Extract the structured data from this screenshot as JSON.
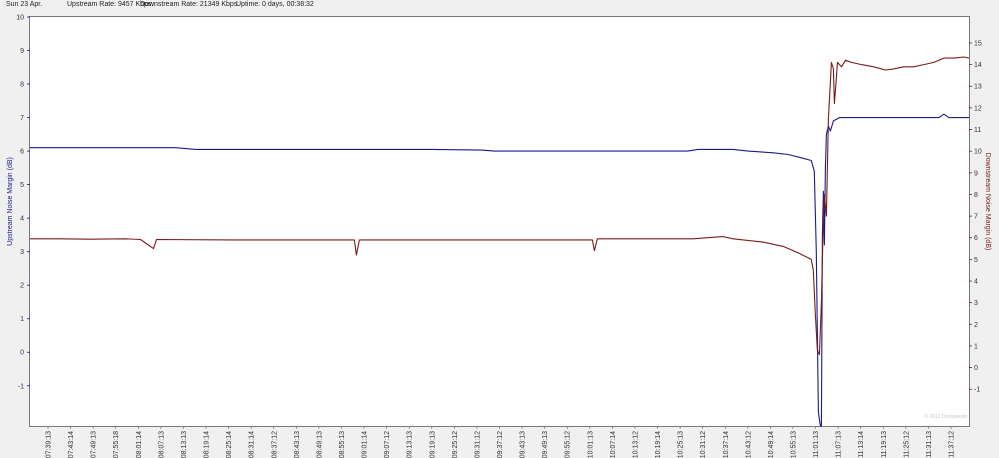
{
  "header": {
    "date": "Sun 23 Apr.",
    "upstream_rate": "Upstream Rate: 9457 Kbps.",
    "downstream_rate": "Downstream Rate: 21349 Kbps.",
    "uptime": "Uptime: 0 days, 00:38:32"
  },
  "watermark": "© 2012 Dezspeeds",
  "chart_data": {
    "type": "line",
    "x_tick_labels": [
      "07:39:13",
      "07:43:14",
      "07:49:13",
      "07:55:18",
      "08:01:14",
      "08:07:13",
      "08:13:13",
      "08:19:14",
      "08:25:14",
      "08:31:14",
      "08:37:12",
      "08:43:13",
      "08:49:13",
      "08:55:13",
      "09:01:14",
      "09:07:12",
      "09:13:13",
      "09:19:13",
      "09:25:12",
      "09:31:12",
      "09:37:12",
      "09:43:13",
      "09:49:13",
      "09:55:12",
      "10:01:13",
      "10:07:14",
      "10:13:12",
      "10:19:14",
      "10:25:13",
      "10:31:12",
      "10:37:14",
      "10:43:12",
      "10:49:14",
      "10:55:13",
      "11:01:13",
      "11:07:13",
      "11:13:14",
      "11:19:13",
      "11:25:12",
      "11:31:13",
      "11:37:12"
    ],
    "left_axis": {
      "label": "Upstream Noise Margin (dB)",
      "range": [
        -2.2,
        10
      ],
      "ticks": [
        -1,
        0,
        1,
        2,
        3,
        4,
        5,
        6,
        7,
        8,
        9,
        10
      ],
      "color": "#1a1a8c"
    },
    "right_axis": {
      "label": "Downstream Noise Margin (dB)",
      "range": [
        -2.7,
        16.2
      ],
      "ticks": [
        -1,
        0,
        1,
        2,
        3,
        4,
        5,
        6,
        7,
        8,
        9,
        10,
        11,
        12,
        13,
        14,
        15
      ],
      "color": "#7a1a1a"
    },
    "grid": false,
    "series": [
      {
        "name": "Upstream Noise Margin (dB)",
        "axis": "left",
        "color": "#1a1a8c",
        "points": [
          [
            0,
            6.1
          ],
          [
            145,
            6.1
          ],
          [
            165,
            6.05
          ],
          [
            200,
            6.05
          ],
          [
            300,
            6.05
          ],
          [
            400,
            6.05
          ],
          [
            450,
            6.03
          ],
          [
            462,
            6.0
          ],
          [
            600,
            6.0
          ],
          [
            655,
            6.0
          ],
          [
            665,
            6.05
          ],
          [
            700,
            6.05
          ],
          [
            715,
            6.0
          ],
          [
            740,
            5.95
          ],
          [
            755,
            5.9
          ],
          [
            768,
            5.8
          ],
          [
            778,
            5.72
          ],
          [
            781,
            5.4
          ],
          [
            783,
            3.0
          ],
          [
            785,
            -1.8
          ],
          [
            787,
            -2.2
          ],
          [
            788,
            -2.2
          ],
          [
            789,
            3.5
          ],
          [
            790,
            4.8
          ],
          [
            791,
            3.2
          ],
          [
            792,
            5.5
          ],
          [
            793,
            6.5
          ],
          [
            795,
            6.75
          ],
          [
            797,
            6.6
          ],
          [
            800,
            6.9
          ],
          [
            806,
            7.0
          ],
          [
            905,
            7.0
          ],
          [
            910,
            7.1
          ],
          [
            915,
            7.0
          ],
          [
            925,
            7.0
          ],
          [
            935,
            7.0
          ]
        ]
      },
      {
        "name": "Downstream Noise Margin (dB)",
        "axis": "right",
        "color": "#7a1a1a",
        "points": [
          [
            0,
            5.95
          ],
          [
            30,
            5.95
          ],
          [
            60,
            5.93
          ],
          [
            95,
            5.95
          ],
          [
            110,
            5.92
          ],
          [
            123,
            5.5
          ],
          [
            126,
            5.92
          ],
          [
            200,
            5.9
          ],
          [
            300,
            5.9
          ],
          [
            323,
            5.9
          ],
          [
            325,
            5.2
          ],
          [
            328,
            5.9
          ],
          [
            400,
            5.9
          ],
          [
            550,
            5.9
          ],
          [
            560,
            5.9
          ],
          [
            562,
            5.4
          ],
          [
            565,
            5.95
          ],
          [
            600,
            5.95
          ],
          [
            660,
            5.95
          ],
          [
            690,
            6.05
          ],
          [
            700,
            5.95
          ],
          [
            730,
            5.8
          ],
          [
            750,
            5.6
          ],
          [
            765,
            5.3
          ],
          [
            778,
            5.0
          ],
          [
            780,
            4.5
          ],
          [
            782,
            2.5
          ],
          [
            784,
            0.8
          ],
          [
            786,
            0.6
          ],
          [
            788,
            3.0
          ],
          [
            790,
            7.0
          ],
          [
            791,
            8.0
          ],
          [
            793,
            7.0
          ],
          [
            795,
            11.5
          ],
          [
            797,
            13.2
          ],
          [
            798,
            14.1
          ],
          [
            800,
            13.8
          ],
          [
            801,
            12.2
          ],
          [
            803,
            13.4
          ],
          [
            804,
            14.1
          ],
          [
            808,
            13.9
          ],
          [
            812,
            14.2
          ],
          [
            818,
            14.1
          ],
          [
            828,
            14.0
          ],
          [
            840,
            13.9
          ],
          [
            852,
            13.75
          ],
          [
            860,
            13.8
          ],
          [
            870,
            13.9
          ],
          [
            880,
            13.9
          ],
          [
            890,
            14.0
          ],
          [
            900,
            14.1
          ],
          [
            910,
            14.3
          ],
          [
            920,
            14.3
          ],
          [
            930,
            14.35
          ],
          [
            935,
            14.3
          ]
        ]
      }
    ]
  }
}
